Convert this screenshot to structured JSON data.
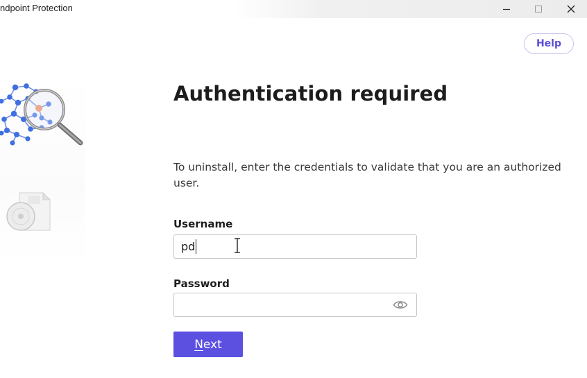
{
  "window": {
    "title": "ndpoint Protection",
    "minimize": "minimize",
    "maximize": "maximize",
    "close": "close"
  },
  "help": {
    "label": "Help"
  },
  "illustration": {
    "top_icon": "network-magnifier-icon",
    "bottom_icon": "software-box-disc-icon"
  },
  "main": {
    "heading": "Authentication required",
    "description": "To uninstall, enter the credentials to validate that you are an authorized user."
  },
  "form": {
    "username": {
      "label": "Username",
      "value": "pd"
    },
    "password": {
      "label": "Password",
      "value": "",
      "toggle_icon": "eye-icon"
    },
    "next": {
      "label_first": "N",
      "label_rest": "ext"
    }
  },
  "colors": {
    "accent": "#5b50e0",
    "help_text": "#5a4fd6",
    "help_border": "#c9c4ee",
    "node_blue": "#3f6fe0",
    "node_orange": "#f08a5a"
  }
}
